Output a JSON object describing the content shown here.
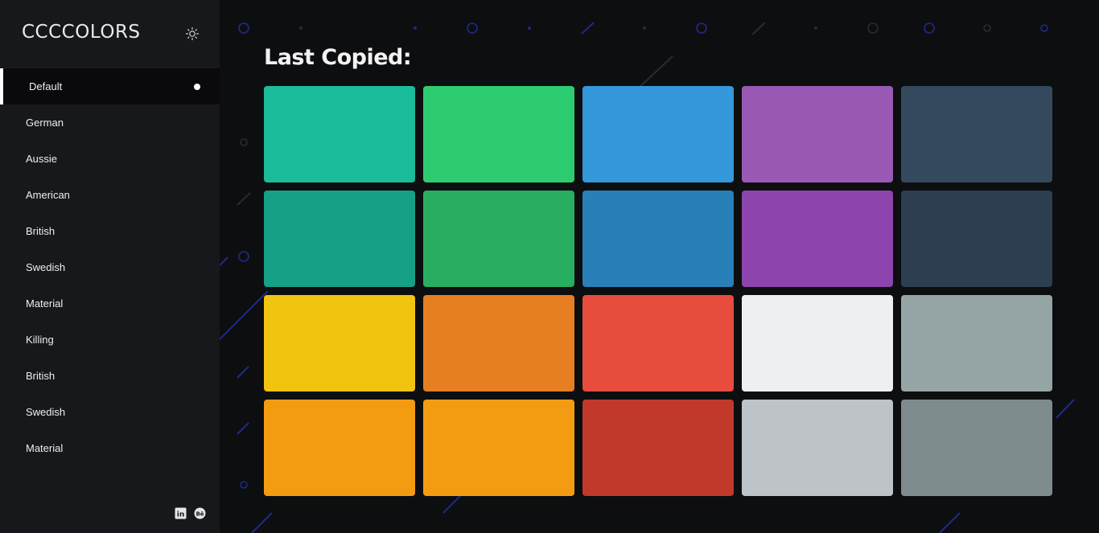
{
  "sidebar": {
    "brand": "CCCCOLORS",
    "theme_icon": "sun-icon",
    "items": [
      {
        "label": "Default",
        "active": true
      },
      {
        "label": "German"
      },
      {
        "label": "Aussie"
      },
      {
        "label": "American"
      },
      {
        "label": "British"
      },
      {
        "label": "Swedish"
      },
      {
        "label": "Material"
      },
      {
        "label": "Killing"
      },
      {
        "label": "British"
      },
      {
        "label": "Swedish"
      },
      {
        "label": "Material"
      }
    ],
    "social": [
      {
        "icon": "linkedin-icon",
        "text": "in"
      },
      {
        "icon": "behance-icon",
        "text": "Bē"
      }
    ]
  },
  "main": {
    "heading": "Last Copied:",
    "swatches": [
      "#1abc9c",
      "#2ecc71",
      "#3498db",
      "#9b59b6",
      "#34495e",
      "#16a085",
      "#27ae60",
      "#2980b9",
      "#8e44ad",
      "#2c3e50",
      "#f1c40f",
      "#e67e22",
      "#e74c3c",
      "#ecf0f1",
      "#95a5a6",
      "#f39c12",
      "#f39c12",
      "#c0392b",
      "#bdc3c7",
      "#7f8c8d"
    ]
  }
}
